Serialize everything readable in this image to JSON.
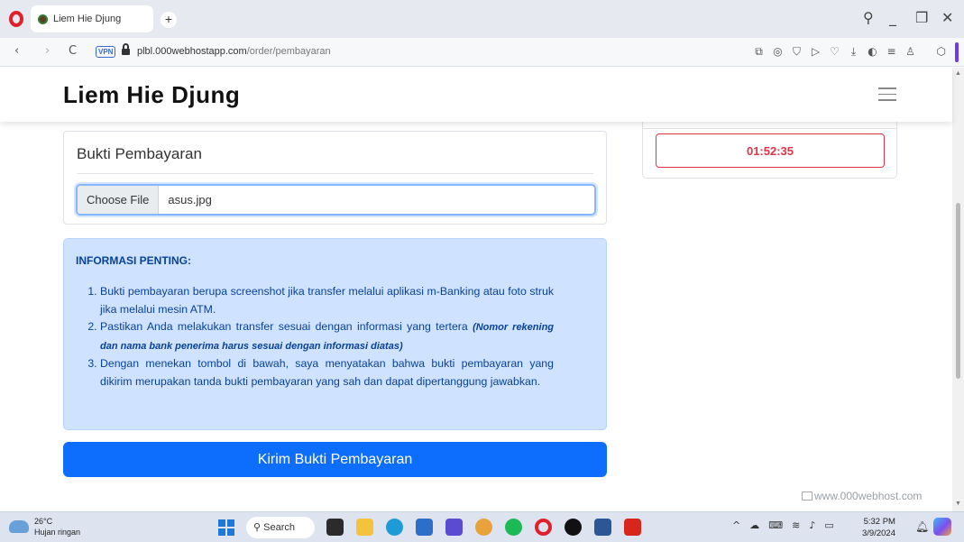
{
  "browser": {
    "tab_title": "Liem Hie Djung",
    "new_tab": "+",
    "url_host": "plbl.000webhostapp.com",
    "url_path": "/order/pembayaran",
    "vpn_label": "VPN",
    "window_minimize": "_",
    "window_restore": "❐",
    "window_close": "✕",
    "search_glyph": "⚲",
    "back_glyph": "‹",
    "forward_glyph": "›",
    "reload_glyph": "C"
  },
  "site": {
    "title": "Liem Hie Djung"
  },
  "upload": {
    "heading": "Bukti Pembayaran",
    "choose_file_label": "Choose File",
    "file_name": "asus.jpg"
  },
  "timer": {
    "value": "01:52:35"
  },
  "info": {
    "title": "INFORMASI PENTING:",
    "items": [
      "Bukti pembayaran berupa screenshot jika transfer melalui aplikasi m-Banking atau foto struk jika melalui mesin ATM.",
      "Pastikan Anda melakukan transfer sesuai dengan informasi yang tertera",
      "Dengan menekan tombol di bawah, saya menyatakan bahwa bukti pembayaran yang dikirim merupakan tanda bukti pembayaran yang sah dan dapat dipertanggung jawabkan."
    ],
    "item2_emphasis": "(Nomor rekening dan nama bank penerima harus sesuai dengan informasi diatas)"
  },
  "submit_label": "Kirim Bukti Pembayaran",
  "hosting_badge": "www.000webhost.com",
  "taskbar": {
    "temperature": "26°C",
    "weather": "Hujan ringan",
    "search_label": "Search",
    "time": "5:32 PM",
    "date": "3/9/2024"
  },
  "colors": {
    "primary": "#0d6efd",
    "info_bg": "#cfe2ff",
    "info_text": "#084298",
    "danger": "#dc3545"
  }
}
